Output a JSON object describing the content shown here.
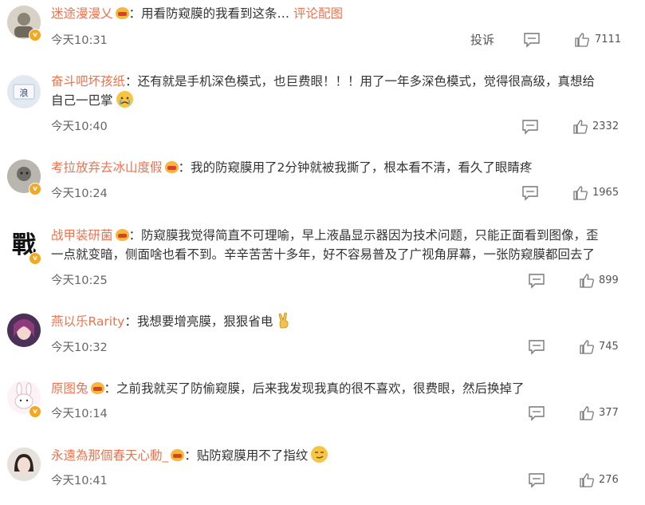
{
  "report_label": "投诉",
  "comments": [
    {
      "user": "迷途漫漫乂",
      "sep": "：",
      "text": "用看防窥膜的我看到这条… ",
      "link": "评论配图",
      "time": "今天10:31",
      "likes": "7111",
      "avatar_color": "#c9c2b4"
    },
    {
      "user": "奋斗吧坏孩纸",
      "sep": "：",
      "text": "还有就是手机深色模式，也巨费眼！！！用了一年多深色模式，觉得很高级，真想给",
      "text2": "自己一巴掌",
      "time": "今天10:40",
      "likes": "2332",
      "avatar_char": "浪",
      "avatar_color": "#dfe6ef"
    },
    {
      "user": "考拉放弃去冰山度假",
      "sep": "：",
      "text": "我的防窥膜用了2分钟就被我撕了，根本看不清，看久了眼睛疼",
      "time": "今天10:24",
      "likes": "1965",
      "avatar_color": "#9a9a94"
    },
    {
      "user": "战甲装研菌",
      "sep": "：",
      "text": "防窥膜我觉得简直不可理喻，早上液晶显示器因为技术问题，只能正面看到图像，歪",
      "text2": "一点就变暗，侧面啥也看不到。辛辛苦苦十多年，好不容易普及了广视角屏幕，一张防窥膜都回去了",
      "time": "今天10:25",
      "likes": "899",
      "avatar_char": "戰",
      "avatar_color": "#ffffff"
    },
    {
      "user": "燕以乐Rarity",
      "sep": "：",
      "text": "我想要增亮膜，狠狠省电",
      "time": "今天10:32",
      "likes": "745",
      "avatar_color": "#5d3f6e"
    },
    {
      "user": "原图兔",
      "sep": "：",
      "text": "之前我就买了防偷窥膜，后来我发现我真的很不喜欢，很费眼，然后换掉了",
      "time": "今天10:14",
      "likes": "377",
      "avatar_color": "#fbeef2"
    },
    {
      "user": "永遠為那個春天心動_",
      "sep": "：",
      "text": "贴防窥膜用不了指纹",
      "time": "今天10:41",
      "likes": "276",
      "avatar_color": "#d8cfc8"
    }
  ]
}
